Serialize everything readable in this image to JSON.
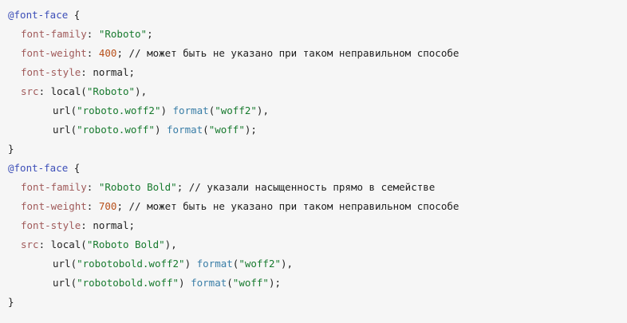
{
  "code": {
    "block1": {
      "at_rule": "@font-face",
      "open_brace": " {",
      "lines": {
        "family": {
          "prop": "font-family",
          "value": "\"Roboto\"",
          "comment": ""
        },
        "weight": {
          "prop": "font-weight",
          "value": "400",
          "comment": " // может быть не указано при таком неправильном способе"
        },
        "style": {
          "prop": "font-style",
          "value": "normal"
        },
        "src": {
          "prop": "src",
          "local_fn": "local",
          "local_arg": "\"Roboto\"",
          "url1_arg": "\"roboto.woff2\"",
          "format1_arg": "\"woff2\"",
          "url2_arg": "\"roboto.woff\"",
          "format2_arg": "\"woff\""
        }
      },
      "close_brace": "}"
    },
    "block2": {
      "at_rule": "@font-face",
      "open_brace": " {",
      "lines": {
        "family": {
          "prop": "font-family",
          "value": "\"Roboto Bold\"",
          "comment": " // указали насыщенность прямо в семействе"
        },
        "weight": {
          "prop": "font-weight",
          "value": "700",
          "comment": " // может быть не указано при таком неправильном способе"
        },
        "style": {
          "prop": "font-style",
          "value": "normal"
        },
        "src": {
          "prop": "src",
          "local_fn": "local",
          "local_arg": "\"Roboto Bold\"",
          "url1_arg": "\"robotobold.woff2\"",
          "format1_arg": "\"woff2\"",
          "url2_arg": "\"robotobold.woff\"",
          "format2_arg": "\"woff\""
        }
      },
      "close_brace": "}"
    },
    "tokens": {
      "url": "url",
      "format": "format",
      "colon": ": ",
      "semicolon": ";",
      "comma": ",",
      "semicolon_end": ";",
      "lparen": "(",
      "rparen": ")",
      "rparen_space": ") "
    }
  }
}
